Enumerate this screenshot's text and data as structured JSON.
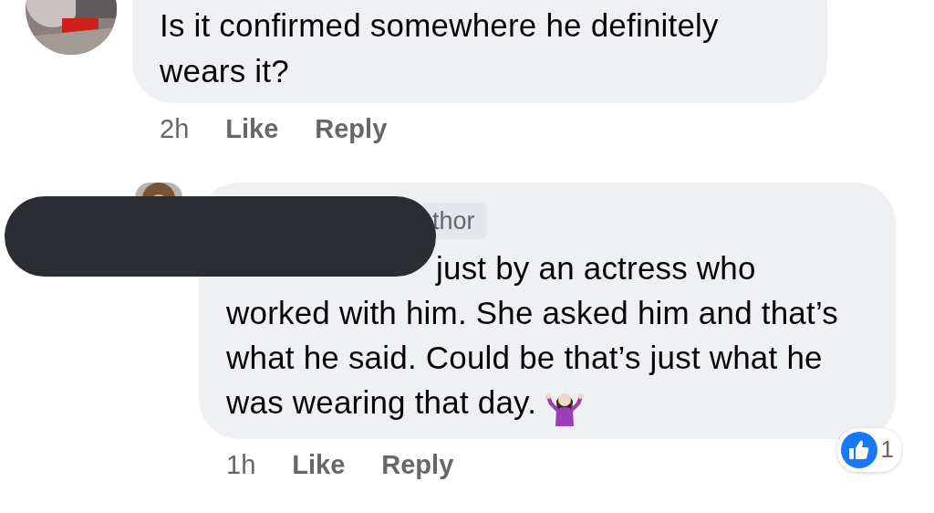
{
  "comments": [
    {
      "avatar": {
        "kind": "picture"
      },
      "text": "Is it confirmed somewhere he definitely wears it?",
      "time": "2h",
      "actions": [
        "Like",
        "Reply"
      ],
      "has_emoji": false,
      "redacted": false,
      "children": [
        {
          "avatar": {
            "kind": "picture"
          },
          "badge": "thor",
          "text": "just by an actress who worked with him. She asked him and that’s what he said. Could be that’s just what he was wearing that day.",
          "time": "1h",
          "actions": [
            "Like",
            "Reply"
          ],
          "has_emoji": true,
          "redacted": true,
          "reactions": {
            "count": "1"
          }
        }
      ]
    }
  ]
}
